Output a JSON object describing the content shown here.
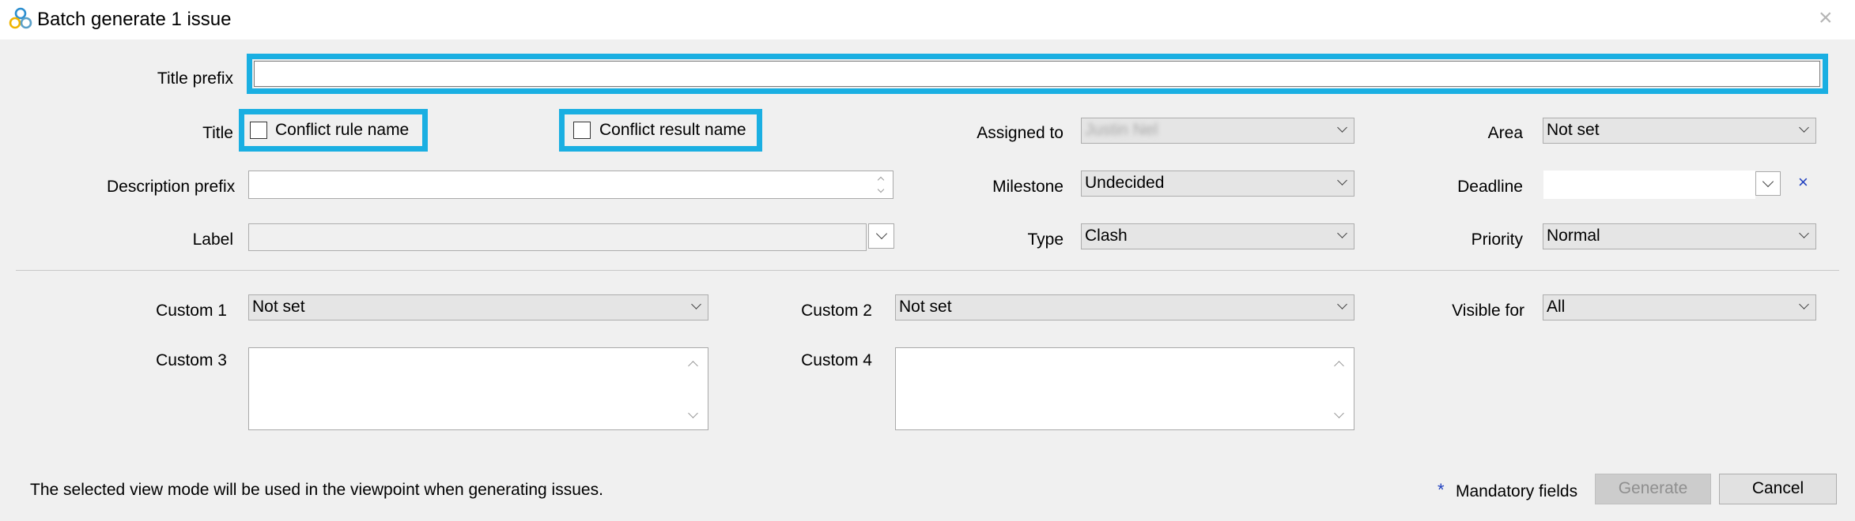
{
  "window": {
    "title": "Batch generate 1 issue",
    "close_icon": "×",
    "app_icon": "triple-ring-logo-icon"
  },
  "form": {
    "title_prefix": {
      "label": "Title prefix",
      "value": ""
    },
    "title": {
      "label": "Title",
      "options": [
        {
          "label": "Conflict rule name",
          "checked": false
        },
        {
          "label": "Conflict result name",
          "checked": false
        }
      ]
    },
    "description_prefix": {
      "label": "Description prefix",
      "value": ""
    },
    "label": {
      "label": "Label",
      "value": ""
    },
    "assigned_to": {
      "label": "Assigned to",
      "value": "Justin Nel"
    },
    "milestone": {
      "label": "Milestone",
      "value": "Undecided"
    },
    "type": {
      "label": "Type",
      "value": "Clash"
    },
    "area": {
      "label": "Area",
      "value": "Not set"
    },
    "deadline": {
      "label": "Deadline",
      "value": "",
      "clear_icon": "×"
    },
    "priority": {
      "label": "Priority",
      "value": "Normal"
    },
    "custom1": {
      "label": "Custom 1",
      "value": "Not set"
    },
    "custom2": {
      "label": "Custom 2",
      "value": "Not set"
    },
    "custom3": {
      "label": "Custom 3",
      "value": ""
    },
    "custom4": {
      "label": "Custom 4",
      "value": ""
    },
    "visible_for": {
      "label": "Visible for",
      "value": "All"
    }
  },
  "footer": {
    "note": "The selected view mode will be used in the viewpoint when generating issues.",
    "mandatory_star": "*",
    "mandatory_label": "Mandatory fields",
    "generate_label": "Generate",
    "cancel_label": "Cancel"
  },
  "colors": {
    "highlight": "#1aafe2",
    "background": "#f0f0f0",
    "mandatory_star": "#1f3fbf",
    "clear_icon": "#1f3fbf"
  }
}
